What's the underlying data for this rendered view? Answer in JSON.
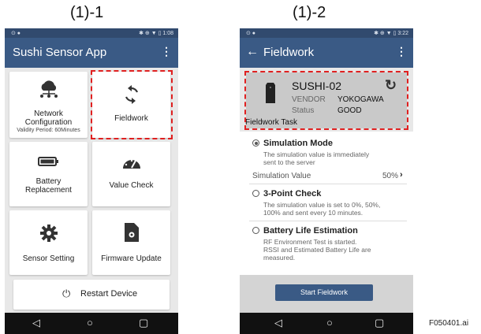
{
  "captions": {
    "left": "(1)-1",
    "right": "(1)-2"
  },
  "file_id": "F050401.ai",
  "phone1": {
    "status_time": "1:08",
    "app_title": "Sushi Sensor App",
    "tiles": {
      "network_line1": "Network",
      "network_line2": "Configuration",
      "network_validity": "Validity Period: 60Minutes",
      "fieldwork": "Fieldwork",
      "battery_line1": "Battery",
      "battery_line2": "Replacement",
      "value_check": "Value Check",
      "sensor_setting": "Sensor Setting",
      "firmware_update": "Firmware Update",
      "restart": "Restart Device"
    }
  },
  "phone2": {
    "status_time": "3:22",
    "title": "Fieldwork",
    "device": {
      "name": "SUSHI-02",
      "vendor_label": "VENDOR",
      "vendor_value": "YOKOGAWA",
      "status_label": "Status",
      "status_value": "GOOD",
      "task_label": "Fieldwork Task"
    },
    "simulation": {
      "title": "Simulation Mode",
      "desc1": "The simulation value is immediately",
      "desc2": "sent to the server",
      "value_label": "Simulation Value",
      "value": "50%"
    },
    "three_point": {
      "title": "3-Point Check",
      "desc1": "The simulation value is set to 0%, 50%,",
      "desc2": "100% and sent every 10 minutes."
    },
    "battery_life": {
      "title": "Battery Life Estimation",
      "desc1": "RF Environment Test is started.",
      "desc2": "RSSI and Estimated Battery Life are",
      "desc3": "measured."
    },
    "start_button": "Start Fieldwork"
  }
}
